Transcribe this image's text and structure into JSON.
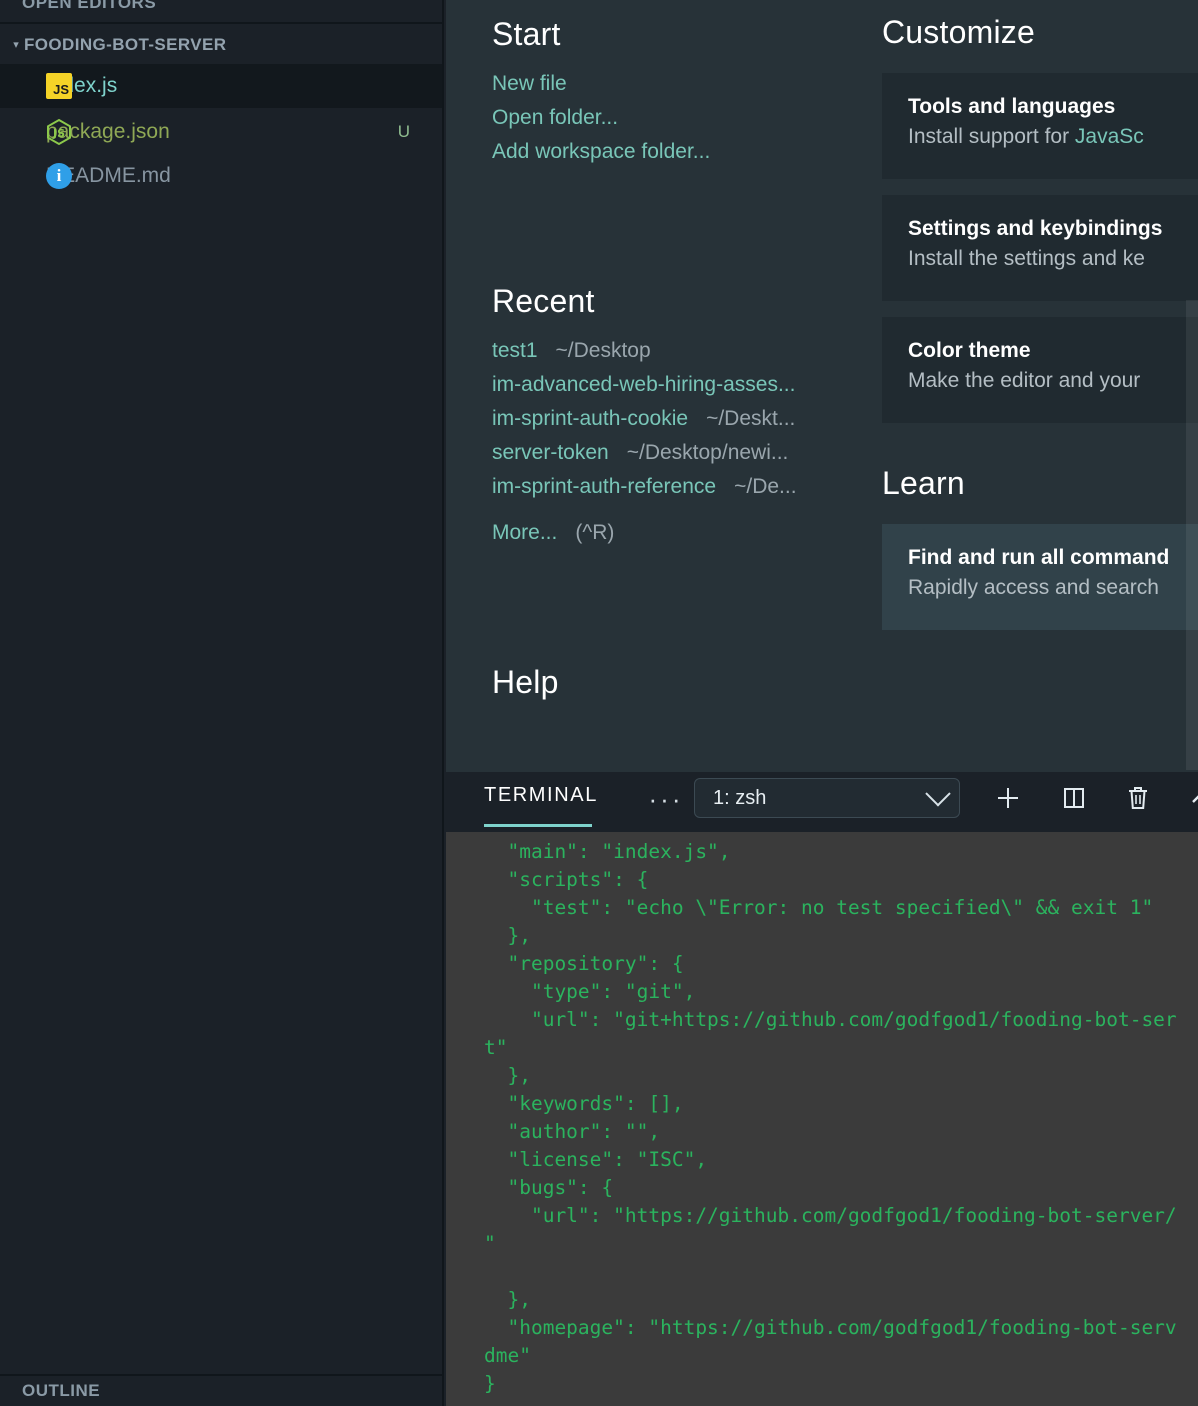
{
  "sidebar": {
    "open_editors_label": "OPEN EDITORS",
    "folder_label": "FOODING-BOT-SERVER",
    "outline_label": "OUTLINE",
    "files": [
      {
        "name": "index.js",
        "icon": "javascript-file-icon",
        "badge": ""
      },
      {
        "name": "package.json",
        "icon": "nodejs-file-icon",
        "badge": "U"
      },
      {
        "name": "README.md",
        "icon": "info-file-icon",
        "badge": ""
      }
    ]
  },
  "welcome": {
    "start": {
      "heading": "Start",
      "links": [
        "New file",
        "Open folder...",
        "Add workspace folder..."
      ]
    },
    "recent": {
      "heading": "Recent",
      "items": [
        {
          "name": "test1",
          "path": "~/Desktop"
        },
        {
          "name": "im-advanced-web-hiring-asses...",
          "path": ""
        },
        {
          "name": "im-sprint-auth-cookie",
          "path": "~/Deskt..."
        },
        {
          "name": "server-token",
          "path": "~/Desktop/newi..."
        },
        {
          "name": "im-sprint-auth-reference",
          "path": "~/De..."
        }
      ],
      "more_label": "More...",
      "more_shortcut": "(^R)"
    },
    "help": {
      "heading": "Help"
    },
    "customize": {
      "heading": "Customize",
      "cards": [
        {
          "title": "Tools and languages",
          "desc_prefix": "Install support for ",
          "desc_accent": "JavaSc"
        },
        {
          "title": "Settings and keybindings",
          "desc_prefix": "Install the settings and ke",
          "desc_accent": ""
        },
        {
          "title": "Color theme",
          "desc_prefix": "Make the editor and your ",
          "desc_accent": ""
        }
      ]
    },
    "learn": {
      "heading": "Learn",
      "cards": [
        {
          "title": "Find and run all command",
          "desc_prefix": "Rapidly access and search",
          "desc_accent": ""
        }
      ]
    }
  },
  "panel": {
    "tab_label": "TERMINAL",
    "more_actions_label": "···",
    "terminal_select_value": "1: zsh",
    "buttons": [
      {
        "name": "new-terminal",
        "icon": "plus-icon"
      },
      {
        "name": "split-terminal",
        "icon": "split-panel-icon"
      },
      {
        "name": "kill-terminal",
        "icon": "trash-icon"
      },
      {
        "name": "collapse-panel",
        "icon": "chevron-up-icon"
      }
    ],
    "terminal_output": "  \"main\": \"index.js\",\n  \"scripts\": {\n    \"test\": \"echo \\\"Error: no test specified\\\" && exit 1\"\n  },\n  \"repository\": {\n    \"type\": \"git\",\n    \"url\": \"git+https://github.com/godfgod1/fooding-bot-ser\nt\"\n  },\n  \"keywords\": [],\n  \"author\": \"\",\n  \"license\": \"ISC\",\n  \"bugs\": {\n    \"url\": \"https://github.com/godfgod1/fooding-bot-server/\n\"\n\n  },\n  \"homepage\": \"https://github.com/godfgod1/fooding-bot-serv\ndme\"\n}"
  },
  "colors": {
    "sidebar_bg": "#1b2128",
    "editor_bg": "#273238",
    "card_bg": "#202a30",
    "card_hover_bg": "#31424a",
    "terminal_bg": "#3b3b3b",
    "terminal_text": "#2bb35e",
    "accent_teal": "#7fd3cc",
    "link_teal": "#79c6b8"
  }
}
